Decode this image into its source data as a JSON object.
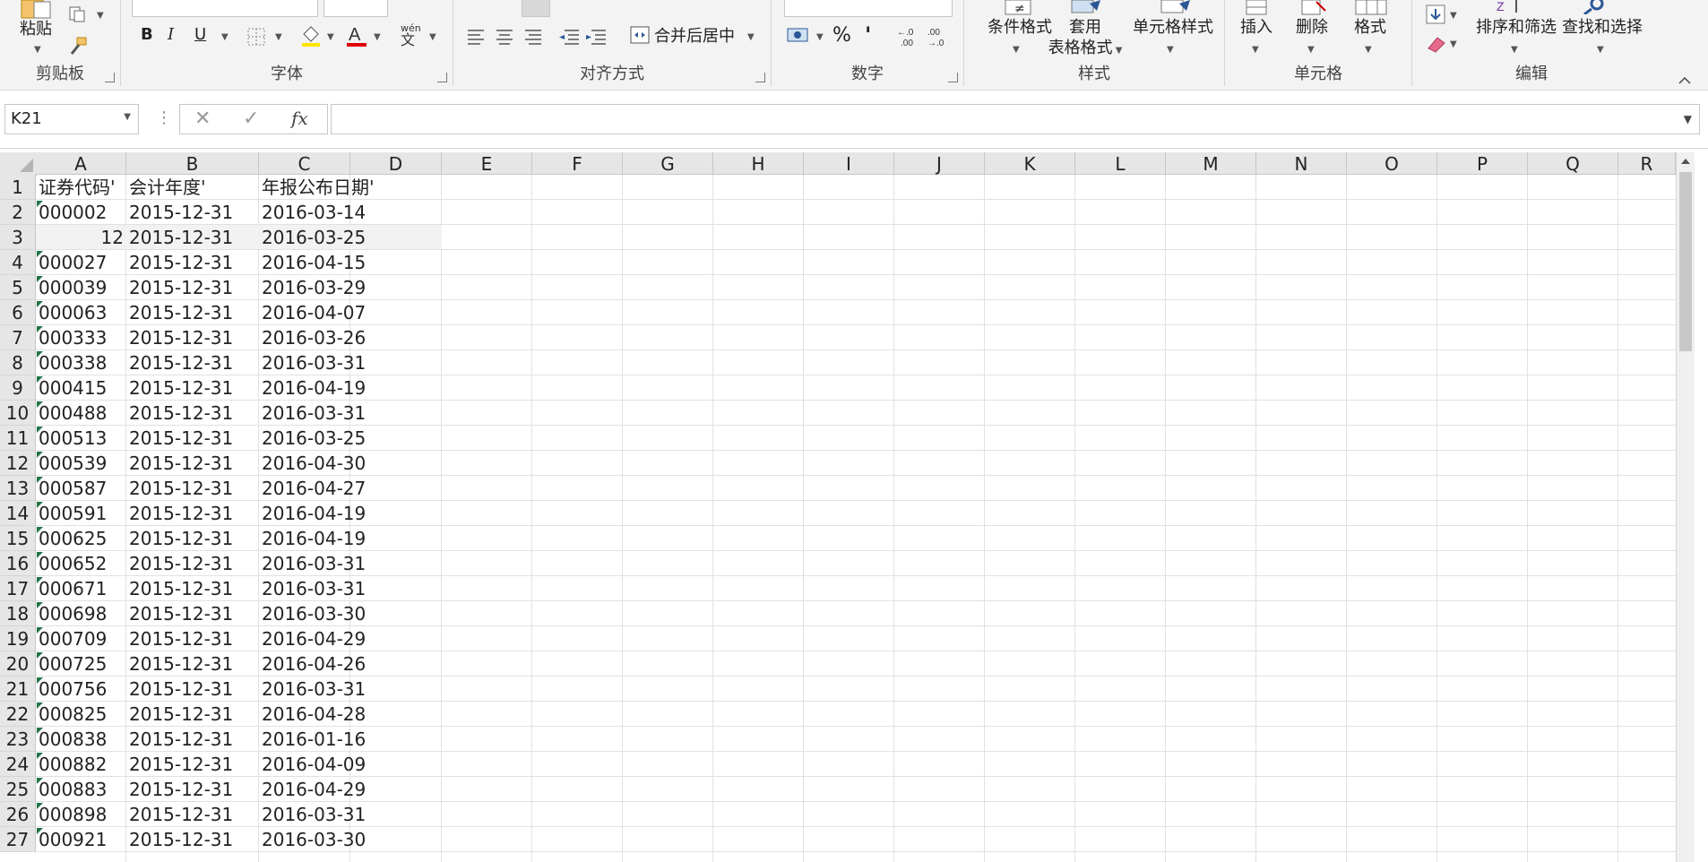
{
  "ribbon": {
    "groups": {
      "clipboard": "剪贴板",
      "font": "字体",
      "alignment": "对齐方式",
      "number": "数字",
      "styles": "样式",
      "cells": "单元格",
      "editing": "编辑"
    },
    "paste_label": "粘贴",
    "merge_center_label": "合并后居中",
    "percent_symbol": "%",
    "comma_symbol": "'",
    "conditional_format_label": "条件格式",
    "table_format_label_1": "套用",
    "table_format_label_2": "表格格式",
    "cell_style_label": "单元格样式",
    "insert_label": "插入",
    "delete_label": "删除",
    "format_label": "格式",
    "sort_filter_label": "排序和筛选",
    "find_select_label": "查找和选择",
    "bold_label": "B",
    "italic_label": "I",
    "underline_label": "U",
    "wen_label": "wén",
    "wen_char": "文",
    "fx_label": "fx"
  },
  "name_box": "K21",
  "formula_value": "",
  "accent_green": "#217346",
  "columns": [
    "A",
    "B",
    "C",
    "D",
    "E",
    "F",
    "G",
    "H",
    "I",
    "J",
    "K",
    "L",
    "M",
    "N",
    "O",
    "P",
    "Q",
    "R"
  ],
  "rows": [
    {
      "n": "1",
      "a": "证券代码'",
      "b": "会计年度'",
      "c": "年报公布日期'",
      "a_num": false,
      "tri": false
    },
    {
      "n": "2",
      "a": "000002",
      "b": "2015-12-31",
      "c": "2016-03-14",
      "a_num": false,
      "tri": true
    },
    {
      "n": "3",
      "a": "12",
      "b": "2015-12-31",
      "c": "2016-03-25",
      "a_num": true,
      "tri": false
    },
    {
      "n": "4",
      "a": "000027",
      "b": "2015-12-31",
      "c": "2016-04-15",
      "a_num": false,
      "tri": true
    },
    {
      "n": "5",
      "a": "000039",
      "b": "2015-12-31",
      "c": "2016-03-29",
      "a_num": false,
      "tri": true
    },
    {
      "n": "6",
      "a": "000063",
      "b": "2015-12-31",
      "c": "2016-04-07",
      "a_num": false,
      "tri": true
    },
    {
      "n": "7",
      "a": "000333",
      "b": "2015-12-31",
      "c": "2016-03-26",
      "a_num": false,
      "tri": true
    },
    {
      "n": "8",
      "a": "000338",
      "b": "2015-12-31",
      "c": "2016-03-31",
      "a_num": false,
      "tri": true
    },
    {
      "n": "9",
      "a": "000415",
      "b": "2015-12-31",
      "c": "2016-04-19",
      "a_num": false,
      "tri": true
    },
    {
      "n": "10",
      "a": "000488",
      "b": "2015-12-31",
      "c": "2016-03-31",
      "a_num": false,
      "tri": true
    },
    {
      "n": "11",
      "a": "000513",
      "b": "2015-12-31",
      "c": "2016-03-25",
      "a_num": false,
      "tri": true
    },
    {
      "n": "12",
      "a": "000539",
      "b": "2015-12-31",
      "c": "2016-04-30",
      "a_num": false,
      "tri": true
    },
    {
      "n": "13",
      "a": "000587",
      "b": "2015-12-31",
      "c": "2016-04-27",
      "a_num": false,
      "tri": true
    },
    {
      "n": "14",
      "a": "000591",
      "b": "2015-12-31",
      "c": "2016-04-19",
      "a_num": false,
      "tri": true
    },
    {
      "n": "15",
      "a": "000625",
      "b": "2015-12-31",
      "c": "2016-04-19",
      "a_num": false,
      "tri": true
    },
    {
      "n": "16",
      "a": "000652",
      "b": "2015-12-31",
      "c": "2016-03-31",
      "a_num": false,
      "tri": true
    },
    {
      "n": "17",
      "a": "000671",
      "b": "2015-12-31",
      "c": "2016-03-31",
      "a_num": false,
      "tri": true
    },
    {
      "n": "18",
      "a": "000698",
      "b": "2015-12-31",
      "c": "2016-03-30",
      "a_num": false,
      "tri": true
    },
    {
      "n": "19",
      "a": "000709",
      "b": "2015-12-31",
      "c": "2016-04-29",
      "a_num": false,
      "tri": true
    },
    {
      "n": "20",
      "a": "000725",
      "b": "2015-12-31",
      "c": "2016-04-26",
      "a_num": false,
      "tri": true
    },
    {
      "n": "21",
      "a": "000756",
      "b": "2015-12-31",
      "c": "2016-03-31",
      "a_num": false,
      "tri": true
    },
    {
      "n": "22",
      "a": "000825",
      "b": "2015-12-31",
      "c": "2016-04-28",
      "a_num": false,
      "tri": true
    },
    {
      "n": "23",
      "a": "000838",
      "b": "2015-12-31",
      "c": "2016-01-16",
      "a_num": false,
      "tri": true
    },
    {
      "n": "24",
      "a": "000882",
      "b": "2015-12-31",
      "c": "2016-04-09",
      "a_num": false,
      "tri": true
    },
    {
      "n": "25",
      "a": "000883",
      "b": "2015-12-31",
      "c": "2016-04-29",
      "a_num": false,
      "tri": true
    },
    {
      "n": "26",
      "a": "000898",
      "b": "2015-12-31",
      "c": "2016-03-31",
      "a_num": false,
      "tri": true
    },
    {
      "n": "27",
      "a": "000921",
      "b": "2015-12-31",
      "c": "2016-03-30",
      "a_num": false,
      "tri": true
    }
  ]
}
